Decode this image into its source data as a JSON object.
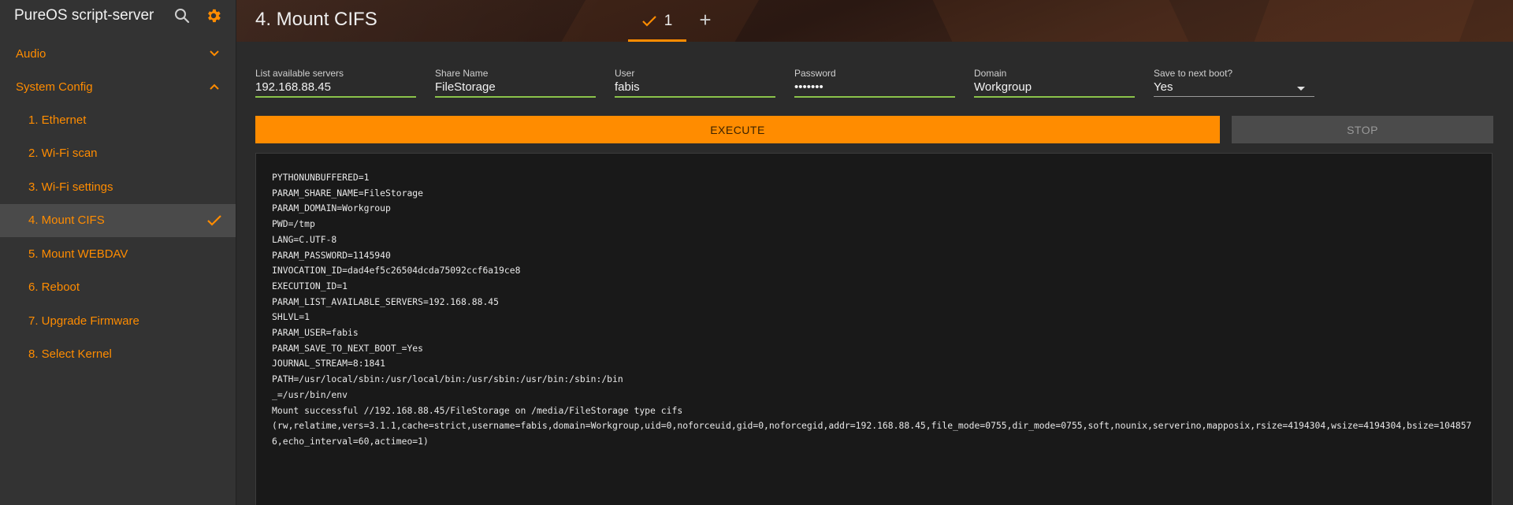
{
  "app": {
    "title": "PureOS script-server",
    "header_icons": [
      "search-icon",
      "gear-icon"
    ],
    "accent_color": "#ff8c00"
  },
  "sidebar": {
    "groups": [
      {
        "label": "Audio",
        "expanded": false
      },
      {
        "label": "System Config",
        "expanded": true
      }
    ],
    "items": [
      {
        "label": "1. Ethernet"
      },
      {
        "label": "2. Wi-Fi scan"
      },
      {
        "label": "3. Wi-Fi settings"
      },
      {
        "label": "4. Mount CIFS",
        "active": true,
        "status_icon": "check-icon"
      },
      {
        "label": "5. Mount WEBDAV"
      },
      {
        "label": "6. Reboot"
      },
      {
        "label": "7. Upgrade Firmware"
      },
      {
        "label": "8. Select Kernel"
      }
    ]
  },
  "header": {
    "script_title": "4. Mount CIFS",
    "execution_tab": {
      "label": "1",
      "status_icon": "check-icon"
    },
    "add_tab_label": "+"
  },
  "parameters": [
    {
      "label": "List available servers",
      "value": "192.168.88.45"
    },
    {
      "label": "Share Name",
      "value": "FileStorage"
    },
    {
      "label": "User",
      "value": "fabis"
    },
    {
      "label": "Password",
      "value": "•••••••"
    },
    {
      "label": "Domain",
      "value": "Workgroup"
    },
    {
      "label": "Save to next boot?",
      "value": "Yes",
      "type": "select"
    }
  ],
  "buttons": {
    "execute": "EXECUTE",
    "stop": "STOP"
  },
  "log": {
    "lines": [
      "PYTHONUNBUFFERED=1",
      "PARAM_SHARE_NAME=FileStorage",
      "PARAM_DOMAIN=Workgroup",
      "PWD=/tmp",
      "LANG=C.UTF-8",
      "PARAM_PASSWORD=1145940",
      "INVOCATION_ID=dad4ef5c26504dcda75092ccf6a19ce8",
      "EXECUTION_ID=1",
      "PARAM_LIST_AVAILABLE_SERVERS=192.168.88.45",
      "SHLVL=1",
      "PARAM_USER=fabis",
      "PARAM_SAVE_TO_NEXT_BOOT_=Yes",
      "JOURNAL_STREAM=8:1841",
      "PATH=/usr/local/sbin:/usr/local/bin:/usr/sbin:/usr/bin:/sbin:/bin",
      "_=/usr/bin/env",
      "Mount successful //192.168.88.45/FileStorage on /media/FileStorage type cifs",
      "(rw,relatime,vers=3.1.1,cache=strict,username=fabis,domain=Workgroup,uid=0,noforceuid,gid=0,noforcegid,addr=192.168.88.45,file_mode=0755,dir_mode=0755,soft,nounix,serverino,mapposix,rsize=4194304,wsize=4194304,bsize=1048576,echo_interval=60,actimeo=1)"
    ]
  }
}
